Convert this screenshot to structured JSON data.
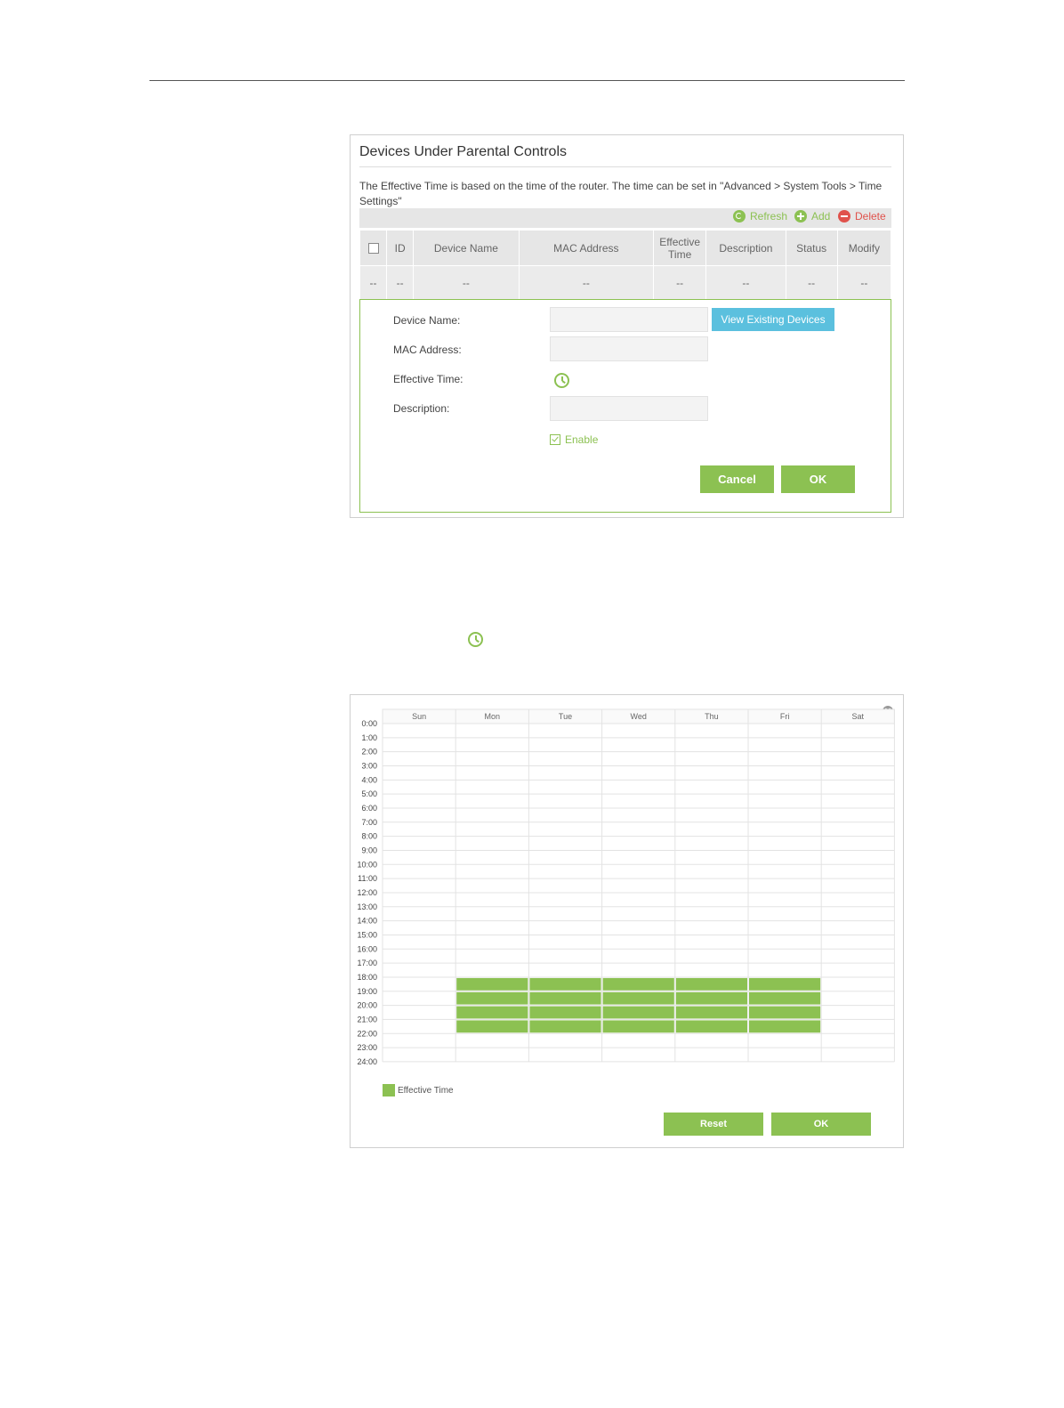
{
  "panel1": {
    "title": "Devices Under Parental Controls",
    "note": "The Effective Time is based on the time of the router. The time can be set in \"Advanced > System Tools > Time Settings\"",
    "toolbar": {
      "refresh": "Refresh",
      "add": "Add",
      "delete": "Delete"
    },
    "table": {
      "headers": {
        "id": "ID",
        "device_name": "Device Name",
        "mac": "MAC Address",
        "effective_line1": "Effective",
        "effective_line2": "Time",
        "description": "Description",
        "status": "Status",
        "modify": "Modify"
      },
      "row": [
        "--",
        "--",
        "--",
        "--",
        "--",
        "--",
        "--",
        "--"
      ]
    },
    "form": {
      "device_name_label": "Device Name:",
      "mac_label": "MAC Address:",
      "effective_time_label": "Effective Time:",
      "description_label": "Description:",
      "view_devices": "View Existing Devices",
      "enable": "Enable",
      "cancel": "Cancel",
      "ok": "OK"
    }
  },
  "schedule": {
    "days": [
      "Sun",
      "Mon",
      "Tue",
      "Wed",
      "Thu",
      "Fri",
      "Sat"
    ],
    "hours": [
      "0:00",
      "1:00",
      "2:00",
      "3:00",
      "4:00",
      "5:00",
      "6:00",
      "7:00",
      "8:00",
      "9:00",
      "10:00",
      "11:00",
      "12:00",
      "13:00",
      "14:00",
      "15:00",
      "16:00",
      "17:00",
      "18:00",
      "19:00",
      "20:00",
      "21:00",
      "22:00",
      "23:00",
      "24:00"
    ],
    "effective": [
      {
        "day": "Mon",
        "start": 18,
        "end": 22
      },
      {
        "day": "Tue",
        "start": 18,
        "end": 22
      },
      {
        "day": "Wed",
        "start": 18,
        "end": 22
      },
      {
        "day": "Thu",
        "start": 18,
        "end": 22
      },
      {
        "day": "Fri",
        "start": 18,
        "end": 22
      }
    ],
    "legend": "Effective Time",
    "reset": "Reset",
    "ok": "OK",
    "color": "#8cc152"
  }
}
